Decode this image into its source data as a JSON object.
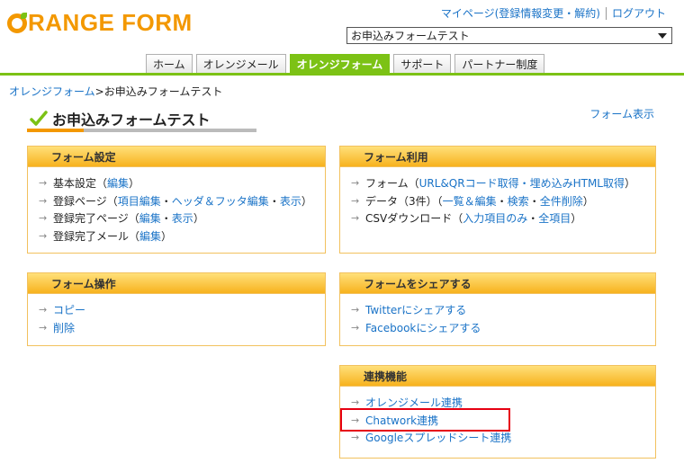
{
  "logo": {
    "rest": "RANGE FORM"
  },
  "account": {
    "mypage": "マイページ(登録情報変更・解約)",
    "logout": "ログアウト"
  },
  "form_select": {
    "selected": "お申込みフォームテスト"
  },
  "tabs": [
    {
      "label": "ホーム"
    },
    {
      "label": "オレンジメール"
    },
    {
      "label": "オレンジフォーム"
    },
    {
      "label": "サポート"
    },
    {
      "label": "パートナー制度"
    }
  ],
  "breadcrumb": {
    "root": "オレンジフォーム",
    "sep": ">",
    "current": "お申込みフォームテスト"
  },
  "page": {
    "title": "お申込みフォームテスト",
    "view_link": "フォーム表示"
  },
  "panels": {
    "settings": {
      "title": "フォーム設定",
      "basic": {
        "label": "基本設定（",
        "edit": "編集",
        "close": "）"
      },
      "reg": {
        "label": "登録ページ（",
        "items": "項目編集",
        "dot1": "・",
        "header": "ヘッダ＆フッタ編集",
        "dot2": "・",
        "view": "表示",
        "close": "）"
      },
      "done": {
        "label": "登録完了ページ（",
        "edit": "編集",
        "dot": "・",
        "view": "表示",
        "close": "）"
      },
      "mail": {
        "label": "登録完了メール（",
        "edit": "編集",
        "close": "）"
      }
    },
    "usage": {
      "title": "フォーム利用",
      "form": {
        "label": "フォーム（",
        "link": "URL&QRコード取得・埋め込みHTML取得",
        "close": "）"
      },
      "data": {
        "label": "データ（3件）（",
        "list": "一覧＆編集",
        "dot1": "・",
        "search": "検索",
        "dot2": "・",
        "delete": "全件削除",
        "close": "）"
      },
      "csv": {
        "label": "CSVダウンロード（",
        "input": "入力項目のみ",
        "dot": "・",
        "all": "全項目",
        "close": "）"
      }
    },
    "ops": {
      "title": "フォーム操作",
      "copy": "コピー",
      "delete": "削除"
    },
    "share": {
      "title": "フォームをシェアする",
      "twitter": "Twitterにシェアする",
      "facebook": "Facebookにシェアする"
    },
    "integration": {
      "title": "連携機能",
      "orange_mail": "オレンジメール連携",
      "chatwork": "Chatwork連携",
      "google": "Googleスプレッドシート連携"
    }
  },
  "colors": {
    "brand_orange": "#f39800",
    "brand_green": "#7cc215",
    "link": "#1a73c7",
    "highlight": "#e60012"
  }
}
